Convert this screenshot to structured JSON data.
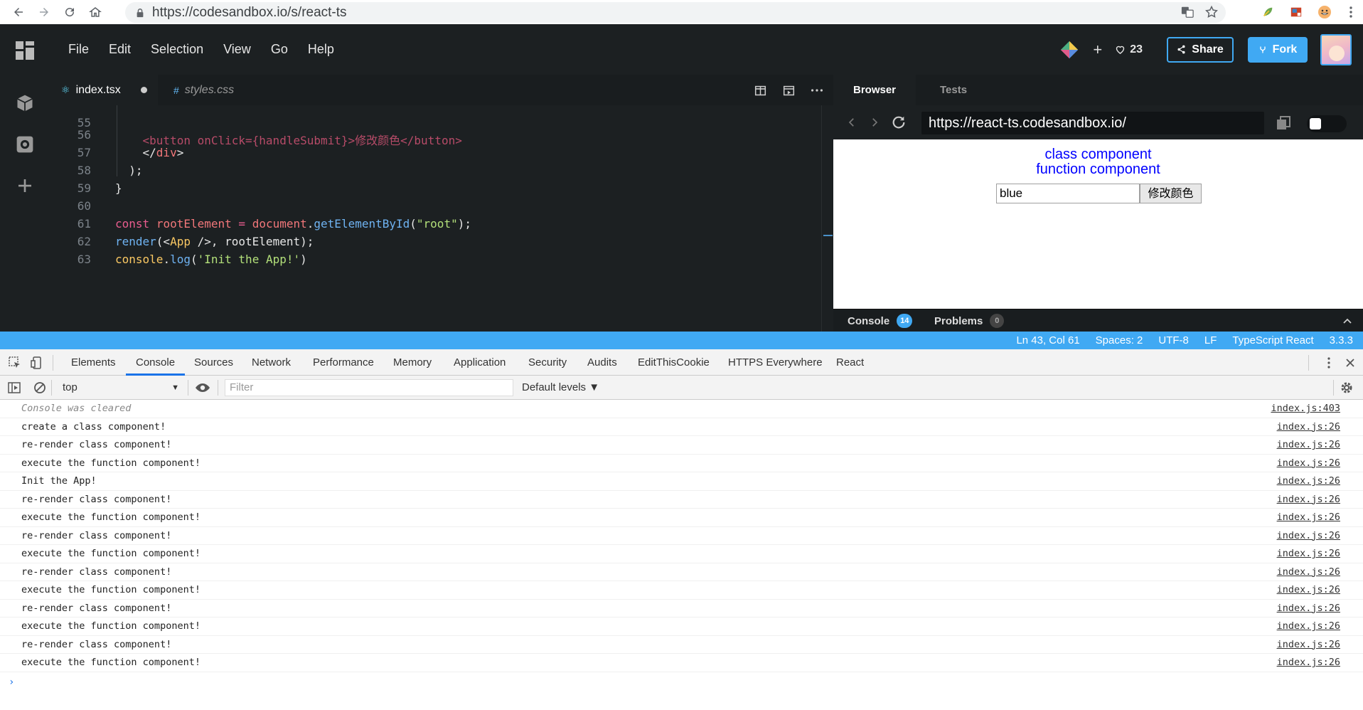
{
  "browser": {
    "url": "https://codesandbox.io/s/react-ts"
  },
  "header": {
    "menu": [
      "File",
      "Edit",
      "Selection",
      "View",
      "Go",
      "Help"
    ],
    "plus": "+",
    "likes": "23",
    "share_label": "Share",
    "fork_label": "Fork"
  },
  "editor": {
    "tabs": [
      {
        "label": "index.tsx",
        "icon": "react-icon",
        "modified": true
      },
      {
        "label": "styles.css",
        "icon": "hash-icon"
      }
    ],
    "lines": [
      {
        "n": "55",
        "text": "    <button onClick={handleSubmit}>修改颜色</button>"
      },
      {
        "n": "56",
        "text": "    </div>"
      },
      {
        "n": "57",
        "text": "  );"
      },
      {
        "n": "58",
        "text": "}"
      },
      {
        "n": "59",
        "text": ""
      },
      {
        "n": "60",
        "text": "const rootElement = document.getElementById(\"root\");"
      },
      {
        "n": "61",
        "text": "render(<App />, rootElement);"
      },
      {
        "n": "62",
        "text": "console.log('Init the App!')"
      },
      {
        "n": "63",
        "text": ""
      }
    ]
  },
  "preview": {
    "tabs": [
      "Browser",
      "Tests"
    ],
    "url": "https://react-ts.codesandbox.io/",
    "page": {
      "line1": "class component",
      "line2": "function component",
      "input_value": "blue",
      "button_label": "修改颜色",
      "text_color": "#0000ff"
    },
    "bottom_tabs": [
      {
        "label": "Console",
        "count": "14"
      },
      {
        "label": "Problems",
        "count": "0"
      }
    ]
  },
  "statusbar": {
    "items": [
      "Ln 43, Col 61",
      "Spaces: 2",
      "UTF-8",
      "LF",
      "TypeScript React",
      "3.3.3"
    ],
    "color": "#40a9f3"
  },
  "devtools": {
    "tabs": [
      "Elements",
      "Console",
      "Sources",
      "Network",
      "Performance",
      "Memory",
      "Application",
      "Security",
      "Audits",
      "EditThisCookie",
      "HTTPS Everywhere",
      "React"
    ],
    "active_tab": "Console",
    "context": "top",
    "filter_placeholder": "Filter",
    "levels": "Default levels ▼",
    "messages": [
      {
        "text": "Console was cleared",
        "src": "index.js:403",
        "cleared": true
      },
      {
        "text": "create a class component!",
        "src": "index.js:26"
      },
      {
        "text": "re-render class component!",
        "src": "index.js:26"
      },
      {
        "text": "execute the function component!",
        "src": "index.js:26"
      },
      {
        "text": "Init the App!",
        "src": "index.js:26"
      },
      {
        "text": "re-render class component!",
        "src": "index.js:26"
      },
      {
        "text": "execute the function component!",
        "src": "index.js:26"
      },
      {
        "text": "re-render class component!",
        "src": "index.js:26"
      },
      {
        "text": "execute the function component!",
        "src": "index.js:26"
      },
      {
        "text": "re-render class component!",
        "src": "index.js:26"
      },
      {
        "text": "execute the function component!",
        "src": "index.js:26"
      },
      {
        "text": "re-render class component!",
        "src": "index.js:26"
      },
      {
        "text": "execute the function component!",
        "src": "index.js:26"
      },
      {
        "text": "re-render class component!",
        "src": "index.js:26"
      },
      {
        "text": "execute the function component!",
        "src": "index.js:26"
      }
    ],
    "prompt": "›"
  }
}
